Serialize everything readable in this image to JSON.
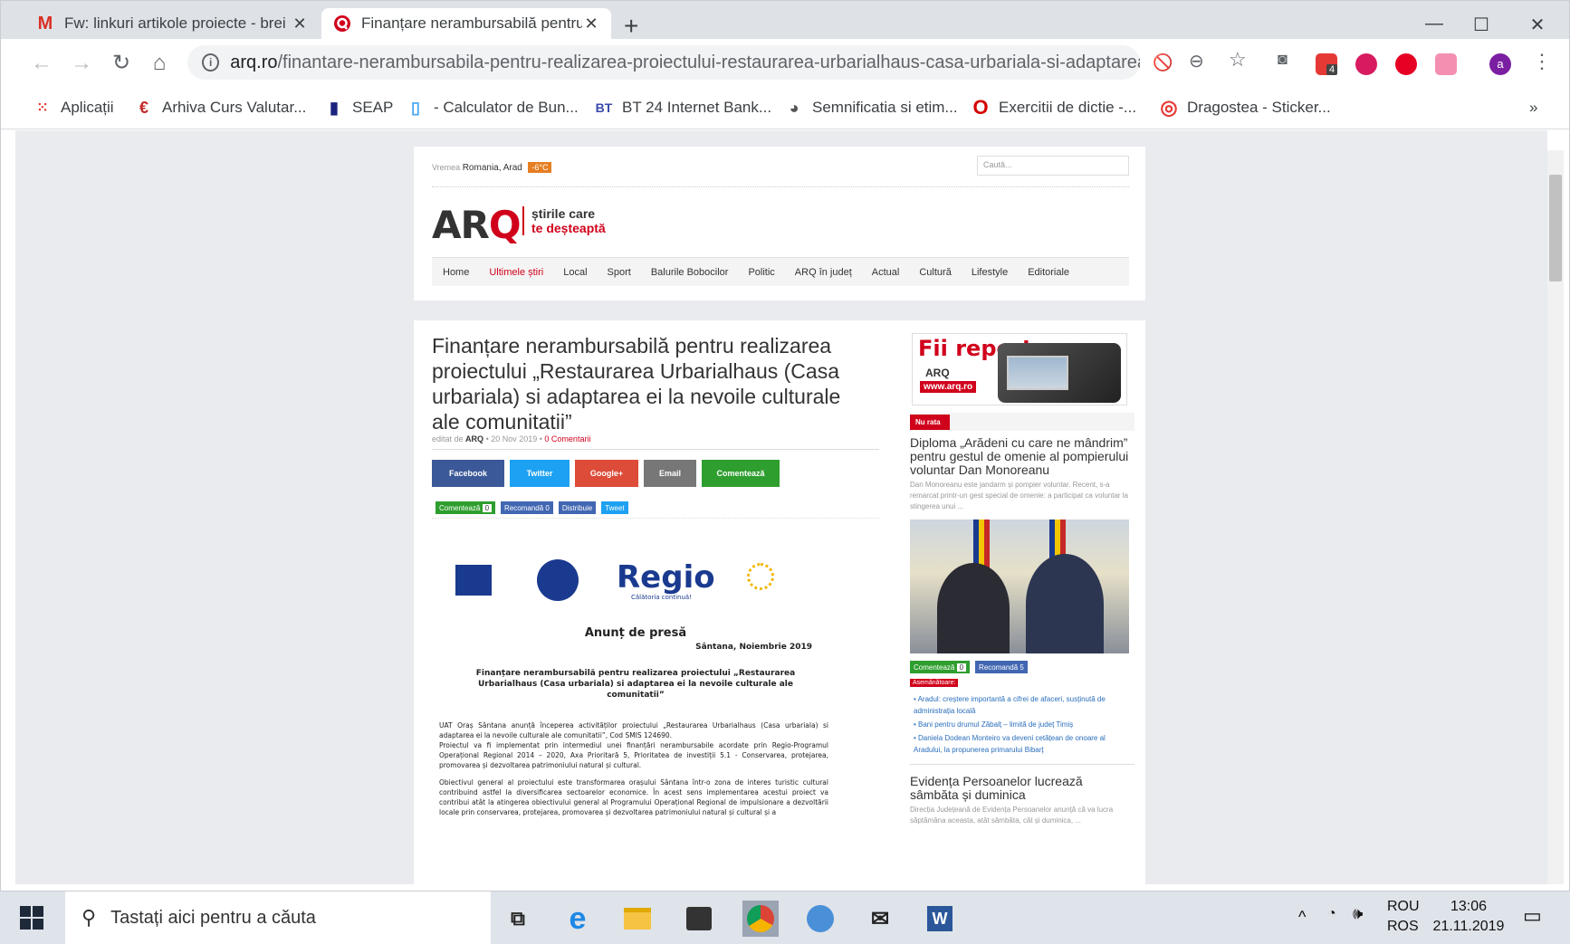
{
  "browser": {
    "tabs": [
      {
        "title": "Fw: linkuri artikole proiecte - brei",
        "close": "✕",
        "icon": "gmail-icon"
      },
      {
        "title": "Finanțare nerambursabilă pentru r",
        "close": "✕",
        "icon": "arq-favicon-icon"
      }
    ],
    "new_tab": "+",
    "window_controls": {
      "minimize": "—",
      "maximize": "☐",
      "close": "✕"
    },
    "url_domain": "arq.ro",
    "url_path": "/finantare-nerambursabila-pentru-realizarea-proiectului-restaurarea-urbarialhaus-casa-urbariala-si-adaptarea-ei...",
    "profile_letter": "a",
    "extension_badge": "4",
    "bookmarks": [
      {
        "label": "Aplicații",
        "icon": "apps-grid-icon"
      },
      {
        "label": "Arhiva Curs Valutar...",
        "icon": "euro-icon"
      },
      {
        "label": "SEAP",
        "icon": "seap-icon"
      },
      {
        "label": "- Calculator de Bun...",
        "icon": "calculator-icon"
      },
      {
        "label": "BT 24 Internet Bank...",
        "icon": "bt-icon"
      },
      {
        "label": "Semnificatia si etim...",
        "icon": "globe-icon"
      },
      {
        "label": "Exercitii de dictie -...",
        "icon": "opera-icon"
      },
      {
        "label": "Dragostea - Sticker...",
        "icon": "circle-icon"
      }
    ],
    "bookmarks_more": "»"
  },
  "site": {
    "weather_label": "Vremea",
    "weather_location": "Romania, Arad",
    "weather_temp": "-6°C",
    "search_placeholder": "Caută...",
    "logo_main": "AR",
    "logo_q": "Q",
    "tagline_1": "știrile care",
    "tagline_2": "te deșteaptă",
    "nav": [
      "Home",
      "Ultimele știri",
      "Local",
      "Sport",
      "Balurile Bobocilor",
      "Politic",
      "ARQ în județ",
      "Actual",
      "Cultură",
      "Lifestyle",
      "Editoriale"
    ]
  },
  "article": {
    "title": "Finanțare nerambursabilă pentru realizarea proiectului „Restaurarea Urbarialhaus (Casa urbariala) si adaptarea ei la nevoile culturale ale comunitatii”",
    "meta_prefix": "editat de",
    "meta_author": "ARQ",
    "meta_date": "• 20 Nov 2019 •",
    "meta_comments": "0 Comentarii",
    "share": [
      {
        "label": "Facebook",
        "color": "#3b5998"
      },
      {
        "label": "Twitter",
        "color": "#1da1f2"
      },
      {
        "label": "Google+",
        "color": "#dd4b39"
      },
      {
        "label": "Email",
        "color": "#777"
      },
      {
        "label": "Comentează",
        "color": "#2e9e2e"
      }
    ],
    "mini": [
      {
        "label": "Comentează",
        "count": "0"
      },
      {
        "label": "Recomandă 0"
      },
      {
        "label": "Distribuie"
      },
      {
        "label": "Tweet"
      }
    ],
    "press": {
      "logo_regio": "Regio",
      "logo_regio_sub": "Călătoria continuă!",
      "anunt": "Anunț de presă",
      "date": "Sântana, Noiembrie 2019",
      "heading": "Finanțare nerambursabilă pentru realizarea proiectului „Restaurarea Urbarialhaus (Casa urbariala) si adaptarea ei la nevoile culturale ale comunitatii”",
      "body_1": "UAT Oraș Sântana anunță începerea activităților proiectului „Restaurarea Urbarialhaus (Casa urbariala) si adaptarea ei la nevoile culturale ale comunitatii”, Cod SMIS 124690.",
      "body_2": "Proiectul va fi implementat prin intermediul unei finanțări nerambursabile acordate prin Regio-Programul Operațional Regional 2014 – 2020, Axa Prioritară 5, Prioritatea de investiții 5.1 - Conservarea, protejarea, promovarea și dezvoltarea patrimoniului natural și cultural.",
      "body_3": "Obiectivul general al proiectului este transformarea orașului Sântana într-o zona de interes turistic cultural contribuind astfel la diversificarea sectoarelor economice. În acest sens implementarea acestui proiect va contribui atât la atingerea obiectivului general al Programului Operațional Regional de impulsionare a dezvoltării locale prin conservarea, protejarea, promovarea și dezvoltarea patrimoniului natural și cultural și a"
    }
  },
  "sidebar": {
    "ad_title": "Fii reporter",
    "ad_url": "www.arq.ro",
    "ad_logo": "ARQ",
    "nu_rata": "Nu rata",
    "story1_title": "Diploma „Arădeni cu care ne mândrim” pentru gestul de omenie al pompierului voluntar Dan Monoreanu",
    "story1_desc": "Dan Monoreanu este jandarm și pompier voluntar. Recent, s-a remarcat printr-un gest special de omenie: a participat ca voluntar la stingerea unui ...",
    "story1_comment": "Comentează",
    "story1_comment_count": "0",
    "story1_recommend": "Recomandă 5",
    "asemanatoare": "Asemănătoare:",
    "links": [
      "• Aradul: creștere importantă a cifrei de afaceri, susținută de administrația locală",
      "• Bani pentru drumul Zăbalț – limită de județ Timiș",
      "• Daniela Dodean Monteiro va deveni cetățean de onoare al Aradului, la propunerea primarului Bibarț"
    ],
    "story2_title": "Evidența Persoanelor lucrează sâmbăta și duminica",
    "story2_desc": "Direcția Județeană de Evidența Persoanelor anunță că va lucra săptămâna aceasta, atât sâmbăta, cât și duminica, ..."
  },
  "taskbar": {
    "search_placeholder": "Tastați aici pentru a căuta",
    "lang_top": "ROU",
    "lang_bottom": "ROS",
    "time": "13:06",
    "date": "21.11.2019"
  }
}
